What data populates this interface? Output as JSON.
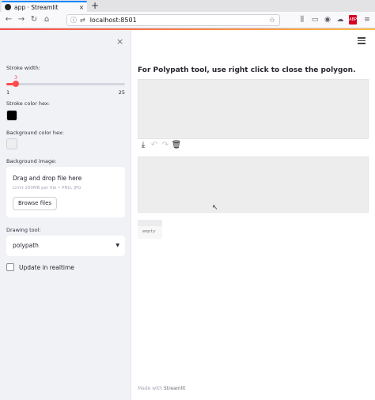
{
  "browser": {
    "tab_title": "app · Streamlit",
    "tab_close": "×",
    "new_tab": "+",
    "url": "localhost:8501",
    "toolbar_badge": "ABP"
  },
  "sidebar": {
    "close": "×",
    "stroke_width": {
      "label": "Stroke width:",
      "value": "3",
      "min": "1",
      "max": "25",
      "fraction": 0.0833
    },
    "stroke_color": {
      "label": "Stroke color hex:",
      "color": "#000000"
    },
    "background_color": {
      "label": "Background color hex:",
      "color": "#eeeeee"
    },
    "background_image": {
      "label": "Background image:",
      "drop_text": "Drag and drop file here",
      "limit_text": "Limit 200MB per file • PNG, JPG",
      "browse_label": "Browse files"
    },
    "drawing_tool": {
      "label": "Drawing tool:",
      "value": "polypath"
    },
    "realtime": {
      "label": "Update in realtime",
      "checked": false
    }
  },
  "main": {
    "title": "For Polypath tool, use right click to close the polygon.",
    "empty_text": "empty",
    "footer_prefix": "Made with ",
    "footer_brand": "Streamlit"
  },
  "colors": {
    "accent": "#ff4b4b",
    "sidebar_bg": "#f0f2f6",
    "canvas_bg": "#eeedee"
  },
  "icons": {
    "toolbar": [
      "download-icon",
      "undo-icon",
      "redo-icon",
      "trash-icon"
    ],
    "menu": "hamburger-menu-icon"
  }
}
